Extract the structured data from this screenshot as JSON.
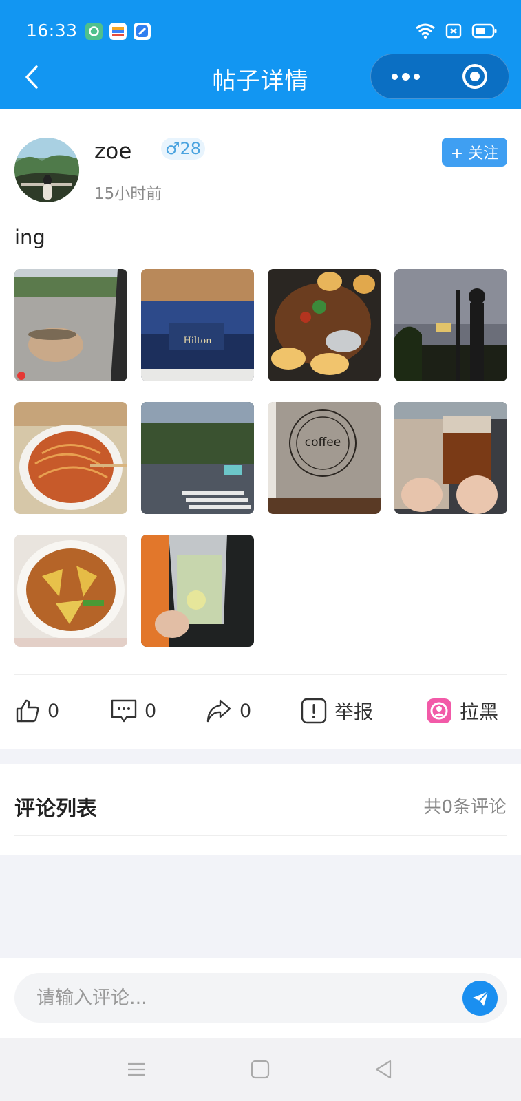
{
  "status_bar": {
    "time": "16:33"
  },
  "nav": {
    "title": "帖子详情"
  },
  "post": {
    "username": "zoe",
    "gender_age": "♂28",
    "time": "15小时前",
    "follow_label": "+ 关注",
    "text": "ing",
    "images": [
      "rainy-window-with-cup",
      "hilton-gift-box",
      "braised-dish-with-potatoes",
      "night-sky-with-pagoda",
      "noodles-in-container",
      "street-crosswalk",
      "coffee-wall-logo",
      "two-iced-coffees",
      "stir-fried-plate",
      "lemon-drink-cup"
    ],
    "stats": {
      "likes": "0",
      "comments": "0",
      "shares": "0"
    },
    "report_label": "举报",
    "block_label": "拉黑"
  },
  "comments": {
    "title": "评论列表",
    "count_text": "共0条评论"
  },
  "input": {
    "placeholder": "请输入评论..."
  },
  "colors": {
    "primary": "#1296f2",
    "follow": "#3f9ff2",
    "block_icon": "#f25aa8"
  }
}
